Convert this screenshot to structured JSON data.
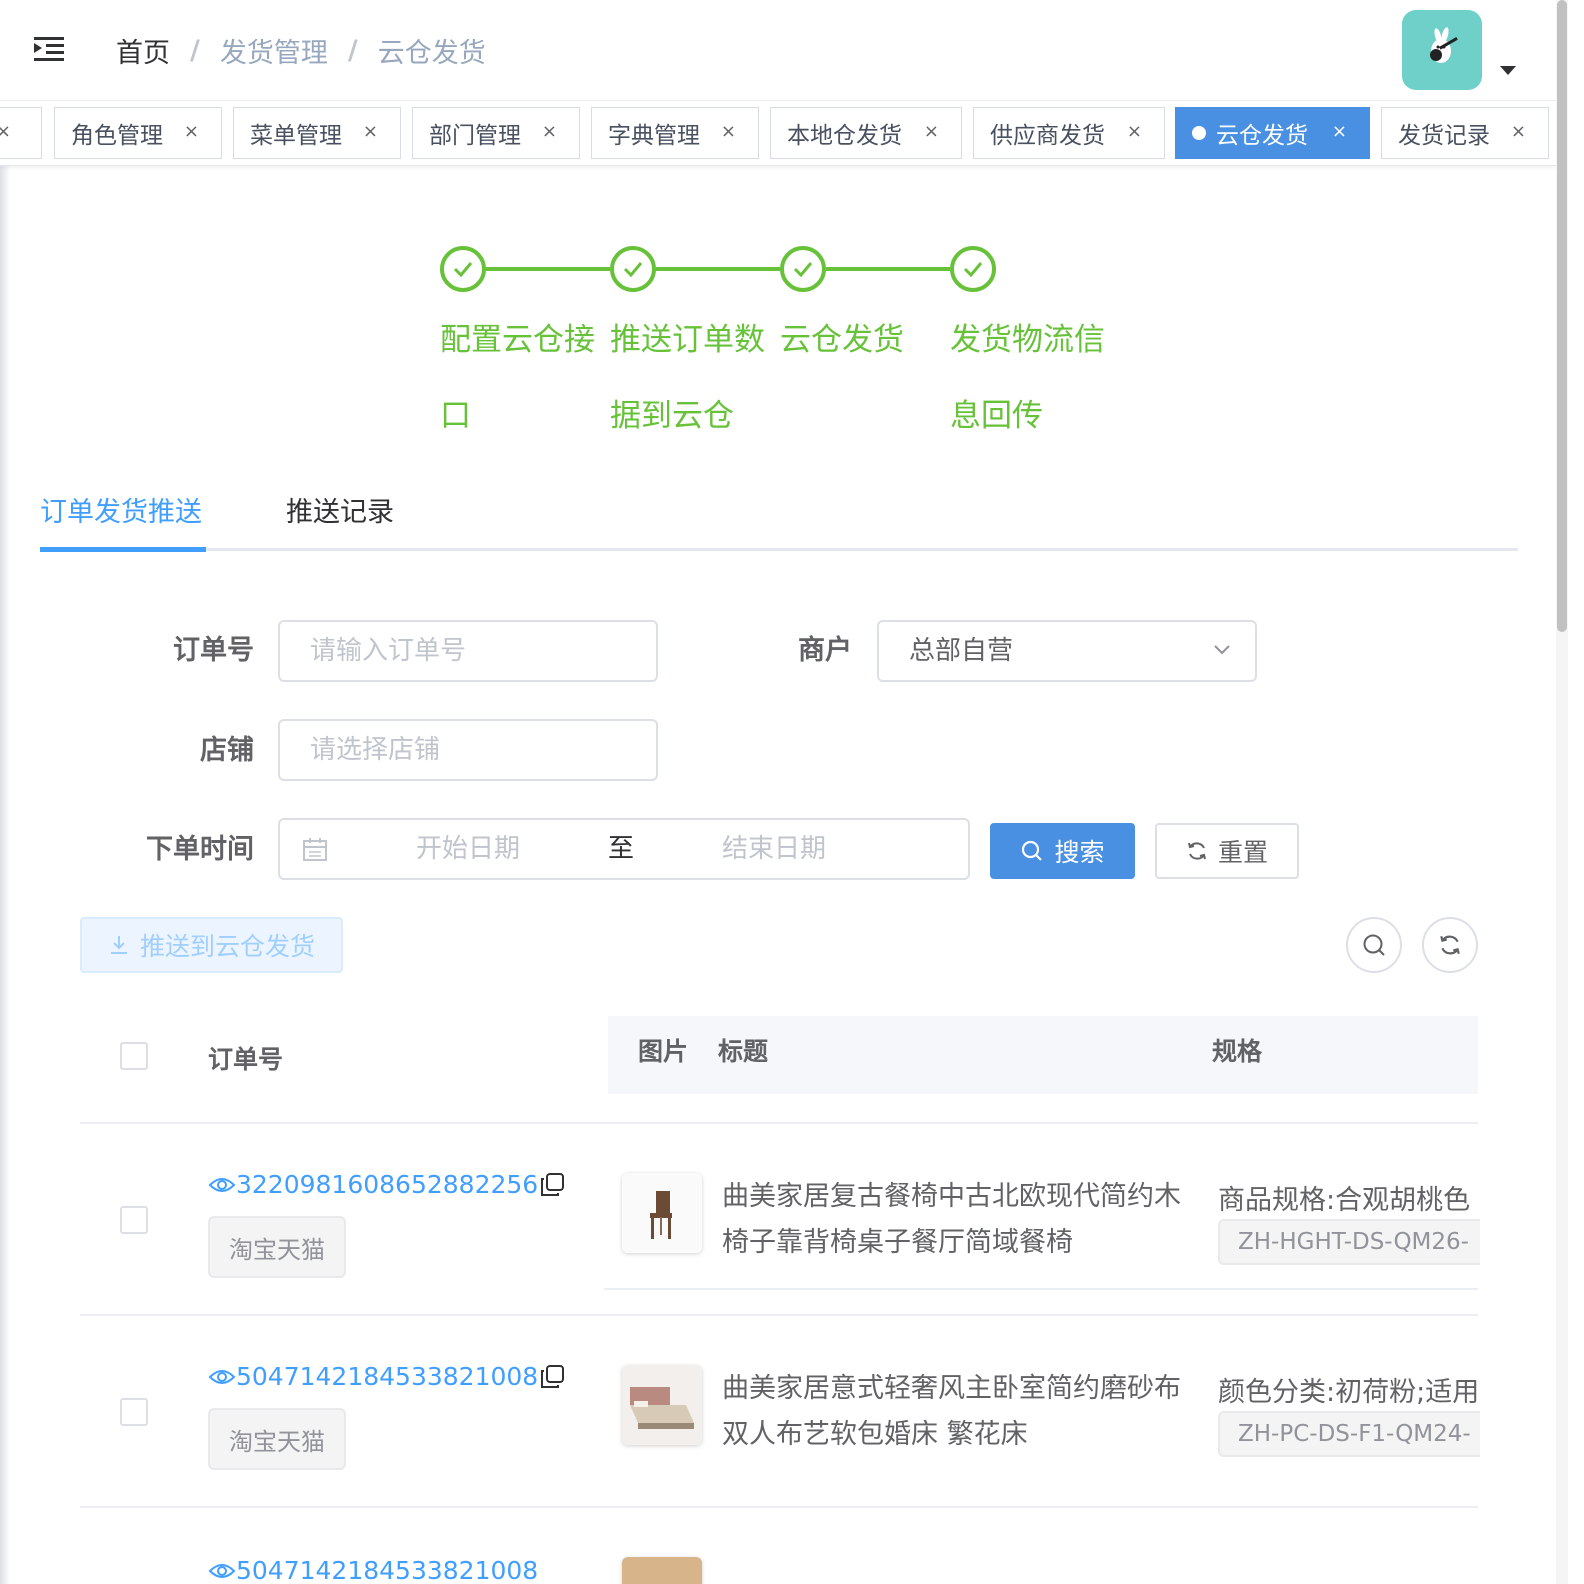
{
  "breadcrumb": {
    "home": "首页",
    "section": "发货管理",
    "current": "云仓发货",
    "separator": "/"
  },
  "tags": [
    {
      "label": "角色管理"
    },
    {
      "label": "菜单管理"
    },
    {
      "label": "部门管理"
    },
    {
      "label": "字典管理"
    },
    {
      "label": "本地仓发货"
    },
    {
      "label": "供应商发货"
    },
    {
      "label": "云仓发货",
      "active": true
    },
    {
      "label": "发货记录"
    }
  ],
  "tag_close": "×",
  "steps": [
    {
      "title": "配置云仓接口",
      "status": "finished"
    },
    {
      "title": "推送订单数据到云仓",
      "status": "finished"
    },
    {
      "title": "云仓发货",
      "status": "finished"
    },
    {
      "title": "发货物流信息回传",
      "status": "finished"
    }
  ],
  "tabs": [
    {
      "label": "订单发货推送",
      "active": true
    },
    {
      "label": "推送记录",
      "active": false
    }
  ],
  "form": {
    "order_no": {
      "label": "订单号",
      "placeholder": "请输入订单号"
    },
    "merchant": {
      "label": "商户",
      "value": "总部自营"
    },
    "shop": {
      "label": "店铺",
      "placeholder": "请选择店铺"
    },
    "order_time": {
      "label": "下单时间",
      "start_placeholder": "开始日期",
      "range_separator": "至",
      "end_placeholder": "结束日期"
    },
    "search_label": "搜索",
    "reset_label": "重置"
  },
  "toolbar": {
    "push_label": "推送到云仓发货"
  },
  "table": {
    "headers": {
      "order_no": "订单号",
      "image": "图片",
      "title": "标题",
      "spec": "规格"
    },
    "rows": [
      {
        "order_no": "3220981608652882256",
        "platform": "淘宝天猫",
        "title": "曲美家居复古餐椅中古北欧现代简约木椅子靠背椅桌子餐厅简域餐椅",
        "spec": "商品规格:合观胡桃色",
        "sku": "ZH-HGHT-DS-QM26-"
      },
      {
        "order_no": "5047142184533821008",
        "platform": "淘宝天猫",
        "title": "曲美家居意式轻奢风主卧室简约磨砂布双人布艺软包婚床 繁花床",
        "spec": "颜色分类:初荷粉;适用",
        "sku": "ZH-PC-DS-F1-QM24-"
      },
      {
        "order_no": "5047142184533821008"
      }
    ]
  },
  "colors": {
    "primary": "#409eff",
    "success": "#67c23a",
    "tag_active": "#4a90e2",
    "avatar": "#6fd0c9"
  }
}
